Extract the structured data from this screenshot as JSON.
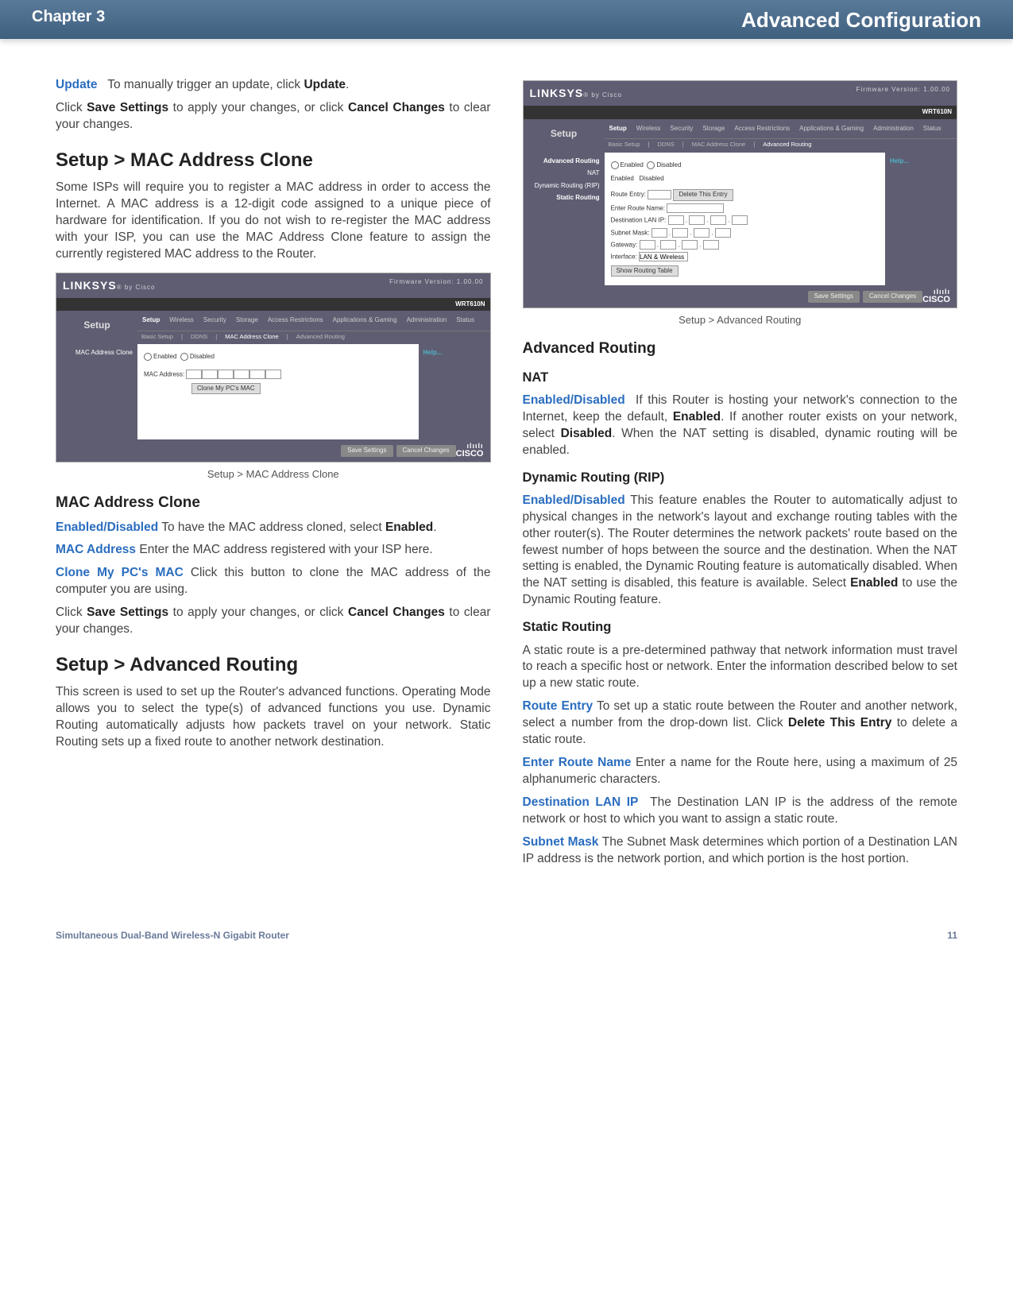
{
  "header": {
    "chapter": "Chapter 3",
    "title": "Advanced Configuration"
  },
  "footer": {
    "product": "Simultaneous Dual-Band Wireless-N Gigabit Router",
    "page": "11"
  },
  "left": {
    "update": {
      "term": "Update",
      "text": "To manually trigger an update, click ",
      "bold": "Update",
      "after": "."
    },
    "save_line": {
      "pre": "Click ",
      "b1": "Save Settings",
      "mid": " to apply your changes, or click ",
      "b2": "Cancel Changes",
      "post": " to clear your changes."
    },
    "h_mac_setup": "Setup > MAC Address Clone",
    "mac_intro": "Some ISPs will require you to register a MAC address in order to access the Internet. A MAC address is a 12-digit code assigned to a unique piece of hardware for identification. If you do not wish to re-register the MAC address with your ISP, you can use the MAC Address Clone feature to assign the currently registered MAC address to the Router.",
    "mac_caption": "Setup > MAC Address Clone",
    "h_mac_clone": "MAC Address Clone",
    "mac_enabled": {
      "term": "Enabled/Disabled",
      "text": "To have the MAC address cloned, select ",
      "bold": "Enabled",
      "after": "."
    },
    "mac_addr": {
      "term": "MAC Address",
      "text": "Enter the MAC address registered with your ISP here."
    },
    "clone": {
      "term": "Clone My PC's MAC",
      "text": "Click this button to clone the MAC address of the computer you are using."
    },
    "h_adv_setup": "Setup > Advanced Routing",
    "adv_intro": "This screen is used to set up the Router's advanced functions. Operating Mode allows you to select the type(s) of advanced functions you use. Dynamic Routing automatically adjusts how packets travel on your network. Static Routing sets up a fixed route to another network destination."
  },
  "right": {
    "adv_caption": "Setup > Advanced Routing",
    "h_adv": "Advanced Routing",
    "h_nat": "NAT",
    "nat": {
      "term": "Enabled/Disabled",
      "text1": "If this Router is hosting your network's connection to the Internet, keep the default, ",
      "b1": "Enabled",
      "text2": ". If another router exists on your network, select ",
      "b2": "Disabled",
      "text3": ". When the NAT setting is disabled, dynamic routing will be enabled."
    },
    "h_rip": "Dynamic Routing (RIP)",
    "rip": {
      "term": "Enabled/Disabled",
      "text1": "This feature enables the Router to automatically adjust to physical changes in the network's layout and exchange routing tables with the other router(s). The Router determines the network packets' route based on the fewest number of hops between the source and the destination. When the NAT setting is enabled, the Dynamic Routing feature is automatically disabled. When the NAT setting is disabled, this feature is available. Select ",
      "b1": "Enabled",
      "text2": " to use the Dynamic Routing feature."
    },
    "h_static": "Static Routing",
    "static_intro": "A static route is a pre-determined pathway that network information must travel to reach a specific host or network. Enter the information described below to set up a new static route.",
    "route_entry": {
      "term": "Route Entry",
      "text1": "To set up a static route between the Router and another network, select a number from the drop-down list. Click ",
      "b1": "Delete This Entry",
      "text2": " to delete a static route."
    },
    "route_name": {
      "term": "Enter Route Name",
      "text": "Enter a name for the Route here, using a maximum of 25 alphanumeric characters."
    },
    "dest_ip": {
      "term": "Destination LAN IP",
      "text": "The Destination LAN IP is the address of the remote network or host to which you want to assign a static route."
    },
    "subnet": {
      "term": "Subnet Mask",
      "text": "The Subnet Mask determines which portion of a Destination LAN IP address is the network portion, and which portion is the host portion."
    }
  },
  "mock": {
    "brand": "LINKSYS",
    "brand_by": "by Cisco",
    "fw": "Firmware Version: 1.00.00",
    "model": "WRT610N",
    "section": "Setup",
    "nav": [
      "Setup",
      "Wireless",
      "Security",
      "Storage",
      "Access Restrictions",
      "Applications & Gaming",
      "Administration",
      "Status"
    ],
    "mac": {
      "subnav": [
        "Basic Setup",
        "DDNS",
        "MAC Address Clone",
        "Advanced Routing"
      ],
      "side": "MAC Address Clone",
      "enabled": "Enabled",
      "disabled": "Disabled",
      "label": "MAC Address:",
      "clone": "Clone My PC's MAC",
      "hint": "Help..."
    },
    "adv": {
      "subnav": [
        "Basic Setup",
        "DDNS",
        "MAC Address Clone",
        "Advanced Routing"
      ],
      "side": [
        "Advanced Routing",
        "NAT",
        "Dynamic Routing (RIP)",
        "Static Routing"
      ],
      "enabled": "Enabled",
      "disabled": "Disabled",
      "route_entry": "Route Entry:",
      "delete": "Delete This Entry",
      "route_name": "Enter Route Name:",
      "dest": "Destination LAN IP:",
      "subnet": "Subnet Mask:",
      "gateway": "Gateway:",
      "iface": "Interface:",
      "iface_val": "LAN & Wireless",
      "show": "Show Routing Table",
      "hint": "Help..."
    },
    "save": "Save Settings",
    "cancel": "Cancel Changes",
    "cisco_top": "ılıılı",
    "cisco": "CISCO"
  }
}
